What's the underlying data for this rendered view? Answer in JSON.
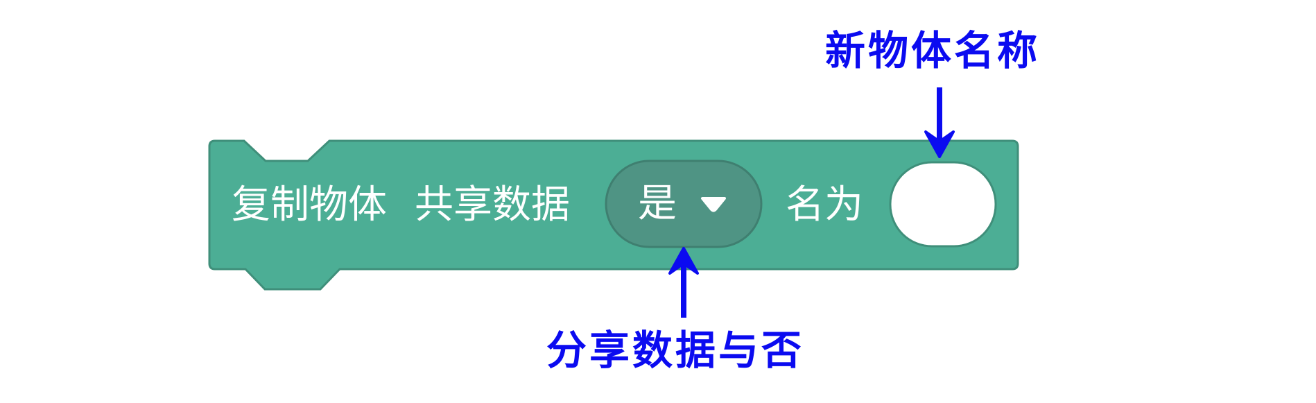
{
  "block": {
    "label_clone": "复制物体",
    "label_share": "共享数据",
    "dropdown_value": "是",
    "label_named": "名为",
    "name_input_value": "",
    "block_color": "#4cae95",
    "block_border": "#3f8f7a",
    "dropdown_color": "#4f9484"
  },
  "annotations": {
    "new_name": "新物体名称",
    "share_or_not": "分享数据与否",
    "color": "#0b0bf0"
  }
}
